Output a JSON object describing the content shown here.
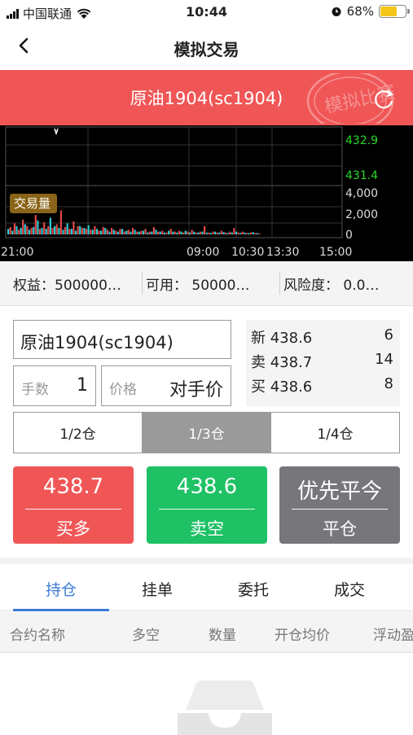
{
  "status_bar": {
    "carrier": "中国联通",
    "time": "10:44",
    "battery": "68%",
    "battery_level": 0.68,
    "icons": [
      "signal-icon",
      "wifi-icon",
      "alarm-icon",
      "battery-icon"
    ]
  },
  "nav": {
    "title": "模拟交易",
    "back_icon": "chevron-left-icon"
  },
  "header": {
    "contract_title": "原油1904(sc1904)",
    "stamp_text": "模拟比赛",
    "refresh_icon": "refresh-icon",
    "color": "#f05656"
  },
  "chart": {
    "price_labels": [
      "432.9",
      "431.4"
    ],
    "volume_labels": [
      "4,000",
      "2,000",
      "0"
    ],
    "volume_badge": "交易量",
    "time_labels": [
      "21:00",
      "09:00",
      "10:30",
      "13:30",
      "15:00"
    ]
  },
  "chart_data": {
    "type": "bar",
    "title": "",
    "volume_axis": {
      "ticks": [
        4000,
        2000,
        0
      ],
      "ylim": [
        0,
        4400
      ]
    },
    "price_axis": {
      "ticks": [
        432.9,
        431.4
      ]
    },
    "x_ticks": [
      "21:00",
      "09:00",
      "10:30",
      "13:30",
      "15:00"
    ],
    "series": [
      {
        "color": "#2cc9d0",
        "values": [
          600,
          400,
          900,
          700,
          1100,
          500,
          800,
          1500,
          700,
          600,
          1800,
          900,
          700,
          500,
          1200,
          600,
          400,
          900,
          700,
          1000,
          500,
          600,
          400,
          700,
          300,
          500,
          300,
          600,
          400,
          300,
          500,
          300,
          400,
          200,
          300,
          500,
          300,
          200,
          400,
          300,
          200,
          300,
          400,
          200,
          300,
          200,
          300,
          200,
          150,
          300,
          200,
          250,
          150,
          200,
          300,
          150,
          200,
          150,
          250,
          150
        ]
      },
      {
        "color": "#e04848",
        "values": [
          800,
          1200,
          500,
          1600,
          900,
          700,
          2100,
          600,
          1300,
          900,
          700,
          1100,
          2600,
          800,
          600,
          1400,
          900,
          700,
          600,
          500,
          900,
          400,
          800,
          500,
          700,
          400,
          600,
          300,
          500,
          700,
          300,
          400,
          600,
          300,
          800,
          300,
          400,
          200,
          600,
          300,
          400,
          200,
          300,
          500,
          200,
          300,
          900,
          200,
          300,
          200,
          400,
          200,
          300,
          700,
          200,
          300,
          150,
          200,
          150,
          100
        ]
      }
    ]
  },
  "account": {
    "equity": "权益：500000…",
    "available": "可用：  50000…",
    "risk": "风险度：  0.0…"
  },
  "order": {
    "contract": "原油1904(sc1904)",
    "qty_label": "手数",
    "qty_value": "1",
    "price_label": "价格",
    "price_value": "对手价"
  },
  "quotes": [
    {
      "label": "新 438.6",
      "volume": "6"
    },
    {
      "label": "卖 438.7",
      "volume": "14"
    },
    {
      "label": "买 438.6",
      "volume": "8"
    }
  ],
  "position_ratio": {
    "options": [
      "1/2仓",
      "1/3仓",
      "1/4仓"
    ],
    "selected": "1/3仓"
  },
  "buttons": {
    "buy": {
      "price": "438.7",
      "action": "买多",
      "color": "#f05656"
    },
    "sell": {
      "price": "438.6",
      "action": "卖空",
      "color": "#1ec164"
    },
    "close": {
      "price": "优先平今",
      "action": "平仓",
      "color": "#77767b"
    }
  },
  "tabs": {
    "items": [
      "持仓",
      "挂单",
      "委托",
      "成交"
    ],
    "active": "持仓"
  },
  "table_headers": [
    "合约名称",
    "多空",
    "数量",
    "开仓均价",
    "浮动盈"
  ],
  "empty_icon": "empty-tray-icon"
}
